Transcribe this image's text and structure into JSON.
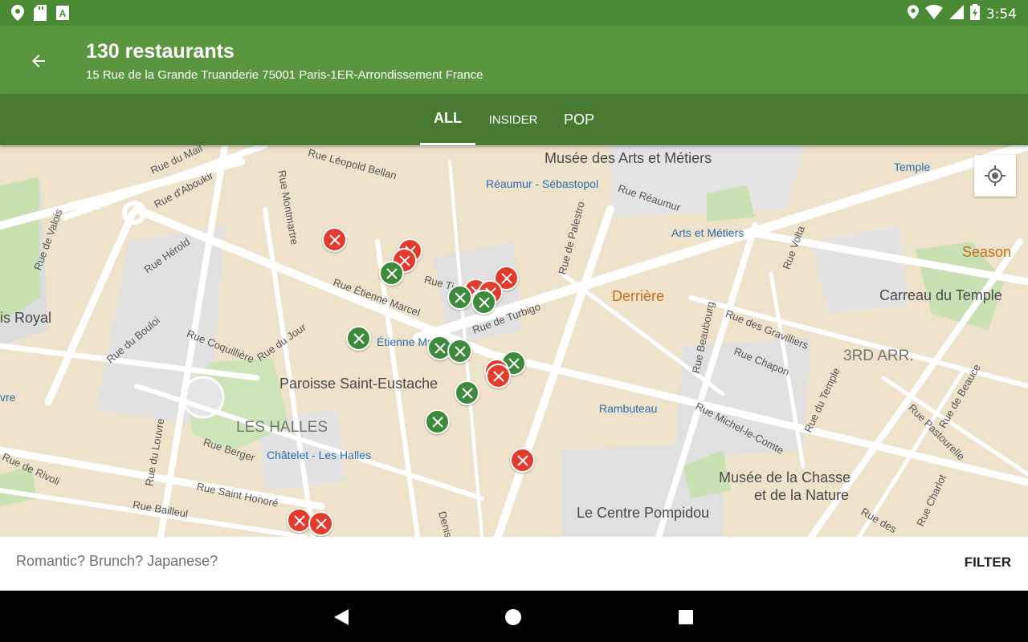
{
  "status_bar": {
    "time": "3:54",
    "left_icons": [
      "location-icon",
      "sd-card-icon",
      "font-app-icon"
    ],
    "right_icons": [
      "location-icon",
      "wifi-icon",
      "signal-icon",
      "battery-charging-icon"
    ]
  },
  "header": {
    "title": "130 restaurants",
    "subtitle": "15 Rue de la Grande Truanderie 75001 Paris-1ER-Arrondissement France"
  },
  "tabs": [
    {
      "label": "ALL",
      "active": true
    },
    {
      "label": "INSIDER",
      "active": false
    },
    {
      "label": "POP",
      "active": false
    }
  ],
  "map": {
    "labels": {
      "musee_arts": "Musée des Arts et Métiers",
      "reaumur_seb": "Réaumur - Sébastopol",
      "temple": "Temple",
      "arts_metiers": "Arts et Métiers",
      "season": "Season",
      "derriere": "Derrière",
      "carreau": "Carreau du Temple",
      "arr3": "3RD ARR.",
      "palais_royal": "is Royal",
      "st_eustache": "Paroisse Saint-Eustache",
      "les_halles": "LES HALLES",
      "chatelet": "Châtelet - Les Halles",
      "etienne_marcel_st": "Étienne Ma",
      "rambuteau": "Rambuteau",
      "musee_chasse_1": "Musée de la Chasse",
      "musee_chasse_2": "et de la Nature",
      "pompidou": "Le Centre Pompidou",
      "louvre_frag": "vre",
      "rue_mail": "Rue du Mail",
      "rue_aboukir": "Rue d'Aboukir",
      "rue_leopold": "Rue Léopold Bellan",
      "rue_montmartre": "Rue Montmartre",
      "rue_valois": "Rue de Valois",
      "rue_herold": "Rue Hérold",
      "rue_reaumur": "Rue Réaumur",
      "rue_palestro": "Rue de Palestro",
      "rue_volta": "Rue Volta",
      "rue_tiq": "Rue Ti",
      "rue_etienne": "Rue Étienne Marcel",
      "rue_turbigo": "Rue de Turbigo",
      "rue_bouloi": "Rue du Bouloi",
      "rue_coquilliere": "Rue Coquillière",
      "rue_jour": "Rue du Jour",
      "rue_beaubourg": "Rue Beaubourg",
      "rue_gravilliers": "Rue des Gravilliers",
      "rue_chapon": "Rue Chapon",
      "rue_temple": "Rue du Temple",
      "rue_beauce": "Rue de Beauce",
      "rue_pastourelle": "Rue Pastourelle",
      "rue_louvre": "Rue du Louvre",
      "rue_berger": "Rue Berger",
      "rue_rivoli": "Rue de Rivoli",
      "rue_st_honore": "Rue Saint Honoré",
      "rue_bailleul": "Rue Bailleul",
      "rue_michel": "Rue Michel-le-Comte",
      "rue_charlot": "Rue Charlot",
      "rue_des": "Rue des",
      "denis": "Denis"
    },
    "pins_red_count": 11,
    "pins_green_count": 10
  },
  "search": {
    "placeholder": "Romantic? Brunch? Japanese?",
    "filter_label": "FILTER"
  },
  "nav": {
    "back": "back-icon",
    "home": "home-icon",
    "recents": "recents-icon"
  },
  "colors": {
    "status_bar": "#4a8a34",
    "app_bar": "#5a9640",
    "tabs_bar": "#487a32",
    "pin_red": "#e53b2c",
    "pin_green": "#3e8a3c"
  }
}
